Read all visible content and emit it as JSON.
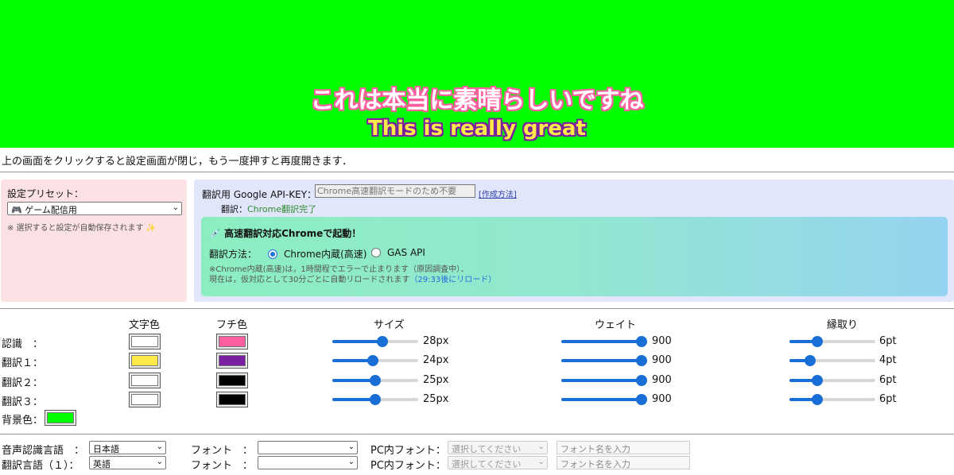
{
  "preview": {
    "line1": "これは本当に素晴らしいですね",
    "line2": "This is really great",
    "bg_color": "#00ff00"
  },
  "hint": "上の画面をクリックすると設定画面が閉じ，もう一度押すと再度開きます．",
  "preset": {
    "label": "設定プリセット：",
    "selected": "🎮 ゲーム配信用",
    "note": "※ 選択すると設定が自動保存されます ✨"
  },
  "api": {
    "label": "翻訳用 Google API-KEY：",
    "placeholder": "Chrome高速翻訳モードのため不要",
    "link": "[作成方法]",
    "status_prefix": "翻訳：",
    "status_value": "Chrome翻訳完了",
    "banner_title": "💉 高速翻訳対応Chromeで起動！",
    "method_label": "翻訳方法：",
    "method_options": [
      "Chrome内蔵(高速)",
      "GAS API"
    ],
    "method_selected": 0,
    "note1": "※Chrome内蔵(高速)は，1時間程でエラーで止まります（原因調査中）．",
    "note2": "現在は，仮対応として30分ごとに自動リロードされます",
    "reload_countdown": "（29:33後にリロード）"
  },
  "style_table": {
    "headers": {
      "text_color": "文字色",
      "outline_color": "フチ色",
      "size": "サイズ",
      "weight": "ウェイト",
      "outline": "縁取り"
    },
    "rows": [
      {
        "label": "認識　：",
        "text_color": "#ffffff",
        "outline_color": "#ff5fa0",
        "size": 28,
        "size_text": "28px",
        "weight": 900,
        "weight_text": "900",
        "outline": 6,
        "outline_text": "6pt"
      },
      {
        "label": "翻訳１：",
        "text_color": "#ffe84a",
        "outline_color": "#7a1fa0",
        "size": 24,
        "size_text": "24px",
        "weight": 900,
        "weight_text": "900",
        "outline": 4,
        "outline_text": "4pt"
      },
      {
        "label": "翻訳２：",
        "text_color": "#ffffff",
        "outline_color": "#000000",
        "size": 25,
        "size_text": "25px",
        "weight": 900,
        "weight_text": "900",
        "outline": 6,
        "outline_text": "6pt"
      },
      {
        "label": "翻訳３：",
        "text_color": "#ffffff",
        "outline_color": "#000000",
        "size": 25,
        "size_text": "25px",
        "weight": 900,
        "weight_text": "900",
        "outline": 6,
        "outline_text": "6pt"
      }
    ],
    "slider_ranges": {
      "size": [
        10,
        40
      ],
      "weight": [
        100,
        900
      ],
      "outline": [
        0,
        20
      ]
    },
    "bg_label": "背景色：",
    "bg_color": "#00ff00"
  },
  "lang_rows": [
    {
      "label": "音声認識言語　：",
      "lang": "日本語",
      "font_label": "フォント　：",
      "font": "",
      "pc_font_label": "PC内フォント：",
      "pc_font_placeholder": "選択してください",
      "font_input_placeholder": "フォント名を入力"
    },
    {
      "label": "翻訳言語（１）：",
      "lang": "英語",
      "font_label": "フォント　：",
      "font": "",
      "pc_font_label": "PC内フォント：",
      "pc_font_placeholder": "選択してください",
      "font_input_placeholder": "フォント名を入力"
    }
  ]
}
